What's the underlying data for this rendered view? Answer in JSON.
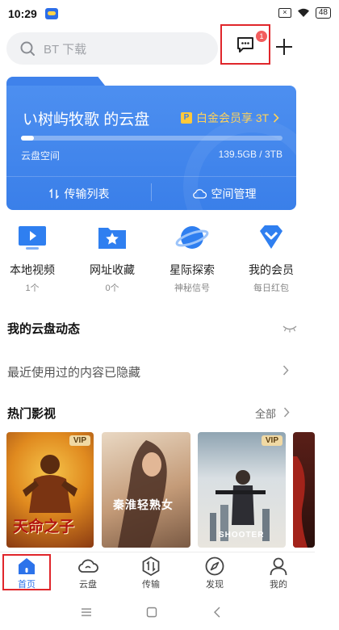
{
  "status_bar": {
    "time": "10:29",
    "battery": "48"
  },
  "search": {
    "placeholder": "BT 下载"
  },
  "messages": {
    "badge_count": "1"
  },
  "cloud_card": {
    "title": "い树屿牧歌 的云盘",
    "vip_promo": "白金会员享 3T",
    "space_label": "云盘空间",
    "space_used": "139.5GB / 3TB",
    "usage_fraction": 0.05,
    "transfer_label": "传输列表",
    "space_manage_label": "空间管理"
  },
  "quick_entries": [
    {
      "label": "本地视频",
      "sub": "1个",
      "icon": "local-video-icon"
    },
    {
      "label": "网址收藏",
      "sub": "0个",
      "icon": "bookmark-folder-icon"
    },
    {
      "label": "星际探索",
      "sub": "神秘信号",
      "icon": "planet-icon"
    },
    {
      "label": "我的会员",
      "sub": "每日红包",
      "icon": "diamond-icon"
    }
  ],
  "dynamics": {
    "title": "我的云盘动态",
    "hidden_text": "最近使用过的内容已隐藏"
  },
  "hot_movies": {
    "title": "热门影视",
    "see_all": "全部",
    "posters": [
      {
        "title": "天命之子",
        "vip": "VIP"
      },
      {
        "title": "秦淮轻熟女",
        "vip": ""
      },
      {
        "title": "SHOOTER",
        "vip": "VIP"
      },
      {
        "title": "",
        "vip": ""
      }
    ]
  },
  "bottom_nav": [
    {
      "label": "首页",
      "icon": "home-icon",
      "active": true
    },
    {
      "label": "云盘",
      "icon": "cloud-icon",
      "active": false
    },
    {
      "label": "传输",
      "icon": "transfer-icon",
      "active": false
    },
    {
      "label": "发现",
      "icon": "compass-icon",
      "active": false
    },
    {
      "label": "我的",
      "icon": "profile-icon",
      "active": false
    }
  ],
  "colors": {
    "accent": "#3a7fe9",
    "highlight": "#e0262b",
    "vip_gold": "#ffd25a"
  }
}
